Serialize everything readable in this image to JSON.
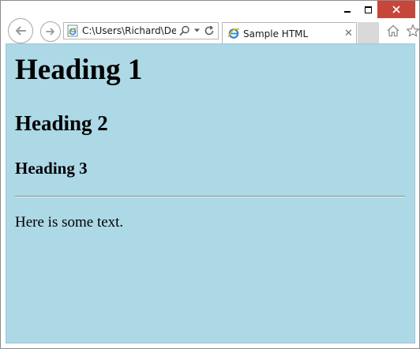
{
  "window": {
    "min_icon": "minimize-icon",
    "max_icon": "maximize-icon",
    "close_icon": "close-icon",
    "close_color": "#c7463a"
  },
  "nav": {
    "back_icon": "back-arrow-icon",
    "forward_icon": "forward-arrow-icon",
    "address": {
      "value": "C:\\Users\\Richard\\Desk",
      "page_icon": "ie-page-icon",
      "search_icon": "search-icon",
      "dropdown_icon": "chevron-down-icon",
      "refresh_icon": "refresh-icon"
    },
    "tab": {
      "label": "Sample HTML",
      "icon": "ie-logo-icon",
      "close_glyph": "✕"
    },
    "home_icon": "home-icon",
    "favorites_icon": "star-icon"
  },
  "content": {
    "background": "#add8e6",
    "h1": "Heading 1",
    "h2": "Heading 2",
    "h3": "Heading 3",
    "paragraph": "Here is some text."
  }
}
